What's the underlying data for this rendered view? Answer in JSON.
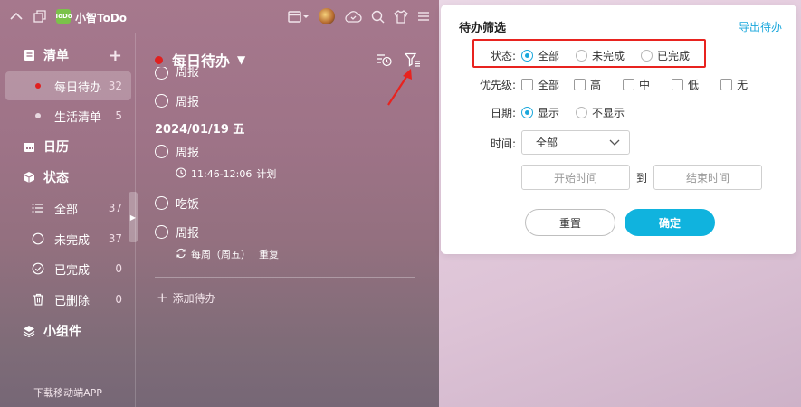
{
  "app": {
    "title": "小智ToDo",
    "logo_text": "ToDo"
  },
  "sidebar": {
    "sections": [
      {
        "label": "清单"
      },
      {
        "label": "日历"
      },
      {
        "label": "状态"
      },
      {
        "label": "小组件"
      }
    ],
    "lists": [
      {
        "label": "每日待办",
        "count": "32"
      },
      {
        "label": "生活清单",
        "count": "5"
      }
    ],
    "status_items": [
      {
        "label": "全部",
        "count": "37"
      },
      {
        "label": "未完成",
        "count": "37"
      },
      {
        "label": "已完成",
        "count": "0"
      },
      {
        "label": "已删除",
        "count": "0"
      }
    ],
    "footer": "下载移动端APP"
  },
  "main": {
    "list_title": "每日待办",
    "tasks": [
      {
        "title": "周报"
      },
      {
        "title": "周报"
      },
      {
        "title": "周报",
        "meta": "11:46-12:06",
        "meta_tag": "计划"
      },
      {
        "title": "吃饭"
      },
      {
        "title": "周报",
        "meta": "每周（周五）",
        "meta_tag": "重复"
      }
    ],
    "date_header": "2024/01/19 五",
    "add_label": "添加待办"
  },
  "filter": {
    "title": "待办筛选",
    "export_label": "导出待办",
    "status": {
      "label": "状态:",
      "options": [
        "全部",
        "未完成",
        "已完成"
      ],
      "selected": "全部"
    },
    "priority": {
      "label": "优先级:",
      "options": [
        "全部",
        "高",
        "中",
        "低",
        "无"
      ]
    },
    "date": {
      "label": "日期:",
      "options": [
        "显示",
        "不显示"
      ],
      "selected": "显示"
    },
    "time": {
      "label": "时间:",
      "selected": "全部",
      "start_placeholder": "开始时间",
      "to_label": "到",
      "end_placeholder": "结束时间"
    },
    "reset_label": "重置",
    "confirm_label": "确定"
  },
  "colors": {
    "accent": "#1aa7dc",
    "confirm": "#10b3de",
    "highlight": "#e8231f",
    "list_dot": "#e02020"
  }
}
